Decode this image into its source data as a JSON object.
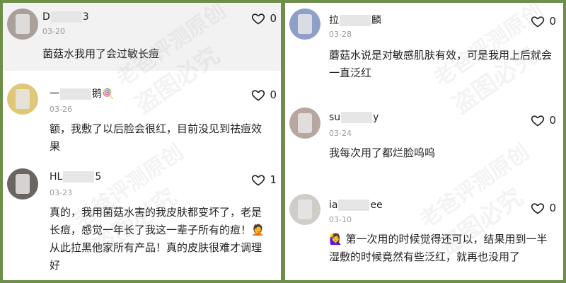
{
  "left": {
    "comments": [
      {
        "name_start": "D",
        "name_end": "3",
        "date": "03-20",
        "text": "菌菇水我用了会过敏长痘",
        "likes": "0"
      },
      {
        "name_start": "一",
        "name_end": "鹅🍭",
        "date": "03-26",
        "text": "额，我敷了以后脸会很红，目前没见到祛痘效果",
        "likes": "0"
      },
      {
        "name_start": "HL",
        "name_end": "5",
        "date": "03-23",
        "text": "真的，我用菌菇水害的我皮肤都变坏了，老是长痘，感觉一年长了我这一辈子所有的痘！🤦 从此拉黑他家所有产品！真的皮肤很难才调理好",
        "likes": "1"
      }
    ]
  },
  "right": {
    "comments": [
      {
        "name_start": "拉",
        "name_end": "麟",
        "date": "03-28",
        "text": "蘑菇水说是对敏感肌肤有效，可是我用上后就会一直泛红",
        "likes": "0"
      },
      {
        "name_start": "su",
        "name_end": "y",
        "date": "03-24",
        "text": "我每次用了都烂脸呜呜",
        "likes": "0"
      },
      {
        "name_start": "ia",
        "name_end": "ee",
        "date": "03-10",
        "text": "🙋‍♀️ 第一次用的时候觉得还可以，结果用到一半湿敷的时候竟然有些泛红，就再也没用了",
        "likes": "0"
      }
    ]
  },
  "watermark": {
    "line1": "老爸评测原创",
    "line2": "盗图必究"
  },
  "colors": {
    "frame": "#6e8f4a",
    "highlight": "#f2f2f2",
    "date": "#9a9a9a"
  }
}
